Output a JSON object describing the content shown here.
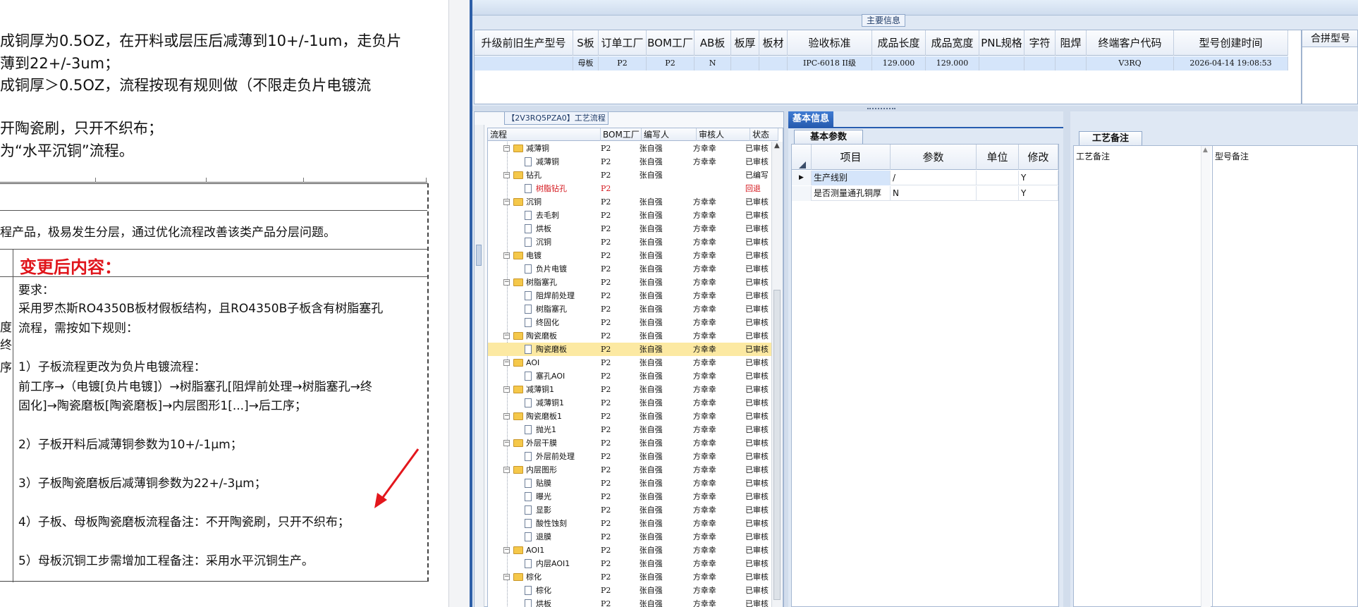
{
  "document": {
    "intro_lines": [
      "成铜厚为0.5OZ，在开料或层压后减薄到10+/-1um，走负片",
      "薄到22+/-3um；",
      "成铜厚＞0.5OZ，流程按现有规则做（不限走负片电镀流",
      "开陶瓷刷，只开不织布；",
      "为“水平沉铜”流程。"
    ],
    "goal_text": "程产品，极易发生分层，通过优化流程改善该类产品分层问题。",
    "after_title": "变更后内容：",
    "side_chars": [
      "度",
      "终",
      "序"
    ],
    "body_lines": [
      "要求：",
      "采用罗杰斯RO4350B板材假板结构，且RO4350B子板含有树脂塞孔",
      "流程，需按如下规则：",
      "1）子板流程更改为负片电镀流程：",
      "前工序→（电镀[负片电镀]）→树脂塞孔[阻焊前处理→树脂塞孔→终",
      "固化]→陶瓷磨板[陶瓷磨板]→内层图形1[...]→后工序；",
      "2）子板开料后减薄铜参数为10+/-1μm；",
      "3）子板陶瓷磨板后减薄铜参数为22+/-3μm；",
      "4）子板、母板陶瓷磨板流程备注：不开陶瓷刷，只开不织布；",
      "5）母板沉铜工步需增加工程备注：采用水平沉铜生产。"
    ],
    "arrow_color": "#e3161c"
  },
  "app": {
    "main_info_tab": "主要信息",
    "main_grid": {
      "columns": [
        "升级前旧生产型号",
        "S板",
        "订单工厂",
        "BOM工厂",
        "AB板",
        "板厚",
        "板材",
        "验收标准",
        "成品长度",
        "成品宽度",
        "PNL规格",
        "字符",
        "阻焊",
        "终端客户代码",
        "型号创建时间"
      ],
      "row": [
        "",
        "母板",
        "P2",
        "P2",
        "N",
        "",
        "",
        "IPC-6018 II级",
        "129.000",
        "129.000",
        "",
        "",
        "",
        "V3RQ",
        "2026-04-14 19:08:53"
      ]
    },
    "merge_panel_title": "合拼型号",
    "process_panel": {
      "tab_label": "【2V3RQ5PZA0】工艺流程",
      "columns": [
        "流程",
        "BOM工厂",
        "编写人",
        "审核人",
        "状态"
      ],
      "rows": [
        {
          "level": 0,
          "type": "folder",
          "name": "减薄铜",
          "bom": "P2",
          "writer": "张自强",
          "checker": "方幸幸",
          "status": "已审核"
        },
        {
          "level": 1,
          "type": "file",
          "name": "减薄铜",
          "bom": "P2",
          "writer": "张自强",
          "checker": "方幸幸",
          "status": "已审核"
        },
        {
          "level": 0,
          "type": "folder",
          "name": "钻孔",
          "bom": "P2",
          "writer": "张自强",
          "checker": "",
          "status": "已编写"
        },
        {
          "level": 1,
          "type": "file",
          "name": "树脂钻孔",
          "bom": "P2",
          "writer": "",
          "checker": "",
          "status": "回退",
          "returned": true
        },
        {
          "level": 0,
          "type": "folder",
          "name": "沉铜",
          "bom": "P2",
          "writer": "张自强",
          "checker": "方幸幸",
          "status": "已审核"
        },
        {
          "level": 1,
          "type": "file",
          "name": "去毛刺",
          "bom": "P2",
          "writer": "张自强",
          "checker": "方幸幸",
          "status": "已审核"
        },
        {
          "level": 1,
          "type": "file",
          "name": "烘板",
          "bom": "P2",
          "writer": "张自强",
          "checker": "方幸幸",
          "status": "已审核"
        },
        {
          "level": 1,
          "type": "file",
          "name": "沉铜",
          "bom": "P2",
          "writer": "张自强",
          "checker": "方幸幸",
          "status": "已审核"
        },
        {
          "level": 0,
          "type": "folder",
          "name": "电镀",
          "bom": "P2",
          "writer": "张自强",
          "checker": "方幸幸",
          "status": "已审核"
        },
        {
          "level": 1,
          "type": "file",
          "name": "负片电镀",
          "bom": "P2",
          "writer": "张自强",
          "checker": "方幸幸",
          "status": "已审核"
        },
        {
          "level": 0,
          "type": "folder",
          "name": "树脂塞孔",
          "bom": "P2",
          "writer": "张自强",
          "checker": "方幸幸",
          "status": "已审核"
        },
        {
          "level": 1,
          "type": "file",
          "name": "阻焊前处理",
          "bom": "P2",
          "writer": "张自强",
          "checker": "方幸幸",
          "status": "已审核"
        },
        {
          "level": 1,
          "type": "file",
          "name": "树脂塞孔",
          "bom": "P2",
          "writer": "张自强",
          "checker": "方幸幸",
          "status": "已审核"
        },
        {
          "level": 1,
          "type": "file",
          "name": "终固化",
          "bom": "P2",
          "writer": "张自强",
          "checker": "方幸幸",
          "status": "已审核"
        },
        {
          "level": 0,
          "type": "folder",
          "name": "陶瓷磨板",
          "bom": "P2",
          "writer": "张自强",
          "checker": "方幸幸",
          "status": "已审核"
        },
        {
          "level": 1,
          "type": "file",
          "name": "陶瓷磨板",
          "bom": "P2",
          "writer": "张自强",
          "checker": "方幸幸",
          "status": "已审核",
          "selected": true
        },
        {
          "level": 0,
          "type": "folder",
          "name": "AOI",
          "bom": "P2",
          "writer": "张自强",
          "checker": "方幸幸",
          "status": "已审核"
        },
        {
          "level": 1,
          "type": "file",
          "name": "塞孔AOI",
          "bom": "P2",
          "writer": "张自强",
          "checker": "方幸幸",
          "status": "已审核"
        },
        {
          "level": 0,
          "type": "folder",
          "name": "减薄铜1",
          "bom": "P2",
          "writer": "张自强",
          "checker": "方幸幸",
          "status": "已审核"
        },
        {
          "level": 1,
          "type": "file",
          "name": "减薄铜1",
          "bom": "P2",
          "writer": "张自强",
          "checker": "方幸幸",
          "status": "已审核"
        },
        {
          "level": 0,
          "type": "folder",
          "name": "陶瓷磨板1",
          "bom": "P2",
          "writer": "张自强",
          "checker": "方幸幸",
          "status": "已审核"
        },
        {
          "level": 1,
          "type": "file",
          "name": "抛光1",
          "bom": "P2",
          "writer": "张自强",
          "checker": "方幸幸",
          "status": "已审核"
        },
        {
          "level": 0,
          "type": "folder",
          "name": "外层干膜",
          "bom": "P2",
          "writer": "张自强",
          "checker": "方幸幸",
          "status": "已审核"
        },
        {
          "level": 1,
          "type": "file",
          "name": "外层前处理",
          "bom": "P2",
          "writer": "张自强",
          "checker": "方幸幸",
          "status": "已审核"
        },
        {
          "level": 0,
          "type": "folder",
          "name": "内层图形",
          "bom": "P2",
          "writer": "张自强",
          "checker": "方幸幸",
          "status": "已审核"
        },
        {
          "level": 1,
          "type": "file",
          "name": "贴膜",
          "bom": "P2",
          "writer": "张自强",
          "checker": "方幸幸",
          "status": "已审核"
        },
        {
          "level": 1,
          "type": "file",
          "name": "曝光",
          "bom": "P2",
          "writer": "张自强",
          "checker": "方幸幸",
          "status": "已审核"
        },
        {
          "level": 1,
          "type": "file",
          "name": "显影",
          "bom": "P2",
          "writer": "张自强",
          "checker": "方幸幸",
          "status": "已审核"
        },
        {
          "level": 1,
          "type": "file",
          "name": "酸性蚀刻",
          "bom": "P2",
          "writer": "张自强",
          "checker": "方幸幸",
          "status": "已审核"
        },
        {
          "level": 1,
          "type": "file",
          "name": "退膜",
          "bom": "P2",
          "writer": "张自强",
          "checker": "方幸幸",
          "status": "已审核"
        },
        {
          "level": 0,
          "type": "folder",
          "name": "AOI1",
          "bom": "P2",
          "writer": "张自强",
          "checker": "方幸幸",
          "status": "已审核"
        },
        {
          "level": 1,
          "type": "file",
          "name": "内层AOI1",
          "bom": "P2",
          "writer": "张自强",
          "checker": "方幸幸",
          "status": "已审核"
        },
        {
          "level": 0,
          "type": "folder",
          "name": "棕化",
          "bom": "P2",
          "writer": "张自强",
          "checker": "方幸幸",
          "status": "已审核"
        },
        {
          "level": 1,
          "type": "file",
          "name": "棕化",
          "bom": "P2",
          "writer": "张自强",
          "checker": "方幸幸",
          "status": "已审核"
        },
        {
          "level": 1,
          "type": "file",
          "name": "烘板",
          "bom": "P2",
          "writer": "张自强",
          "checker": "方幸幸",
          "status": "已审核"
        }
      ]
    },
    "basic_panel": {
      "tab_label": "基本信息",
      "subtab_label": "基本参数",
      "columns": [
        "项目",
        "参数",
        "单位",
        "修改"
      ],
      "rows": [
        {
          "indicator": "▶",
          "item": "生产线别",
          "param": "/",
          "unit": "",
          "modify": "Y"
        },
        {
          "indicator": "",
          "item": "是否测量通孔铜厚",
          "param": "N",
          "unit": "",
          "modify": "Y"
        }
      ]
    },
    "remark_panel": {
      "subtab_label": "工艺备注",
      "process_remark_label": "工艺备注",
      "model_remark_label": "型号备注"
    }
  }
}
